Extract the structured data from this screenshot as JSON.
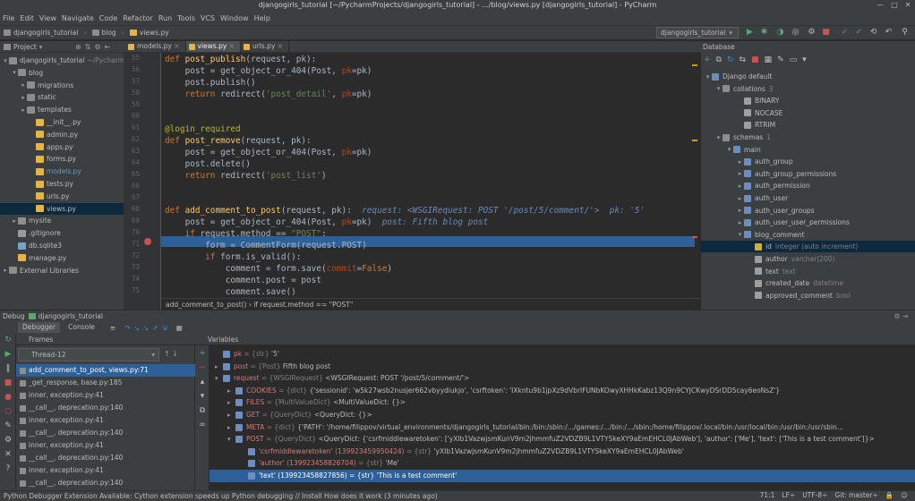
{
  "window": {
    "title": "djangogirls_tutorial [~/PycharmProjects/djangogirls_tutorial] - .../blog/views.py [djangogirls_tutorial] - PyCharm"
  },
  "menu": [
    "File",
    "Edit",
    "View",
    "Navigate",
    "Code",
    "Refactor",
    "Run",
    "Tools",
    "VCS",
    "Window",
    "Help"
  ],
  "breadcrumbs": [
    "djangogirls_tutorial",
    "blog",
    "views.py"
  ],
  "run_config": "djangogirls_tutorial",
  "project_panel": {
    "title": "Project"
  },
  "tabs": [
    "models.py",
    "views.py",
    "urls.py"
  ],
  "tree": [
    {
      "label": "djangogirls_tutorial",
      "suffix": "~/Pycharm",
      "arrow": "▾",
      "icon": "folder",
      "indent": 0
    },
    {
      "label": "blog",
      "arrow": "▾",
      "icon": "folder",
      "indent": 1
    },
    {
      "label": "migrations",
      "arrow": "▸",
      "icon": "folder",
      "indent": 2
    },
    {
      "label": "static",
      "arrow": "▸",
      "icon": "folder",
      "indent": 2
    },
    {
      "label": "templates",
      "arrow": "▸",
      "icon": "folder",
      "indent": 2
    },
    {
      "label": "__init__.py",
      "arrow": "",
      "icon": "py",
      "indent": 3
    },
    {
      "label": "admin.py",
      "arrow": "",
      "icon": "py",
      "indent": 3
    },
    {
      "label": "apps.py",
      "arrow": "",
      "icon": "py",
      "indent": 3
    },
    {
      "label": "forms.py",
      "arrow": "",
      "icon": "py",
      "indent": 3
    },
    {
      "label": "models.py",
      "arrow": "",
      "icon": "py",
      "indent": 3,
      "blue": true
    },
    {
      "label": "tests.py",
      "arrow": "",
      "icon": "py",
      "indent": 3
    },
    {
      "label": "urls.py",
      "arrow": "",
      "icon": "py",
      "indent": 3
    },
    {
      "label": "views.py",
      "arrow": "",
      "icon": "py",
      "indent": 3,
      "selected": true
    },
    {
      "label": "mysite",
      "arrow": "▸",
      "icon": "folder",
      "indent": 1
    },
    {
      "label": ".gitignore",
      "arrow": "",
      "icon": "misc",
      "indent": 1
    },
    {
      "label": "db.sqlite3",
      "arrow": "",
      "icon": "db",
      "indent": 1
    },
    {
      "label": "manage.py",
      "arrow": "",
      "icon": "py",
      "indent": 1
    },
    {
      "label": "External Libraries",
      "arrow": "▸",
      "icon": "folder",
      "indent": 0
    }
  ],
  "line_numbers": [
    "55",
    "56",
    "57",
    "58",
    "59",
    "60",
    "61",
    "62",
    "63",
    "64",
    "65",
    "66",
    "67",
    "68",
    "69",
    "70",
    "71",
    "72",
    "73",
    "74",
    "75"
  ],
  "code_lines": [
    [
      [
        "kw",
        "def "
      ],
      [
        "fn",
        "post_publish"
      ],
      [
        "",
        "(request, pk):"
      ]
    ],
    [
      [
        "",
        "    post = get_object_or_404(Post, "
      ],
      [
        "par",
        "pk"
      ],
      [
        "",
        "=pk)"
      ]
    ],
    [
      [
        "",
        "    post.publish()"
      ]
    ],
    [
      [
        "kw",
        "    return "
      ],
      [
        "",
        "redirect("
      ],
      [
        "st",
        "'post_detail'"
      ],
      [
        "",
        ", "
      ],
      [
        "par",
        "pk"
      ],
      [
        "",
        "=pk)"
      ]
    ],
    [
      [
        "",
        ""
      ]
    ],
    [
      [
        "",
        ""
      ]
    ],
    [
      [
        "dec",
        "@login_required"
      ]
    ],
    [
      [
        "kw",
        "def "
      ],
      [
        "fn",
        "post_remove"
      ],
      [
        "",
        "(request, pk):"
      ]
    ],
    [
      [
        "",
        "    post = get_object_or_404(Post, "
      ],
      [
        "par",
        "pk"
      ],
      [
        "",
        "=pk)"
      ]
    ],
    [
      [
        "",
        "    post.delete()"
      ]
    ],
    [
      [
        "kw",
        "    return "
      ],
      [
        "",
        "redirect("
      ],
      [
        "st",
        "'post_list'"
      ],
      [
        "",
        ")"
      ]
    ],
    [
      [
        "",
        ""
      ]
    ],
    [
      [
        "",
        ""
      ]
    ],
    [
      [
        "kw",
        "def "
      ],
      [
        "fn",
        "add_comment_to_post"
      ],
      [
        "",
        "(request, pk):  "
      ],
      [
        "hint",
        "request: <WSGIRequest: POST '/post/5/comment/'>  pk: '5'"
      ]
    ],
    [
      [
        "",
        "    post = get_object_or_404(Post, "
      ],
      [
        "par",
        "pk"
      ],
      [
        "",
        "=pk)  "
      ],
      [
        "hint",
        "post: Fifth blog post"
      ]
    ],
    [
      [
        "kw",
        "    if "
      ],
      [
        "",
        "request.method == "
      ],
      [
        "st",
        "\"POST\""
      ],
      [
        "",
        ":"
      ]
    ],
    [
      [
        "",
        "        form = CommentForm(request.POST)"
      ]
    ],
    [
      [
        "kw",
        "        if "
      ],
      [
        "",
        "form.is_valid():"
      ]
    ],
    [
      [
        "",
        "            comment = form.save("
      ],
      [
        "par",
        "commit"
      ],
      [
        "",
        "="
      ],
      [
        "kw",
        "False"
      ],
      [
        "",
        ")"
      ]
    ],
    [
      [
        "",
        "            comment.post = post"
      ]
    ],
    [
      [
        "",
        "            comment.save()"
      ]
    ]
  ],
  "editor_breadcrumb": "add_comment_to_post()  ›  if request.method == \"POST\"",
  "db": {
    "title": "Database",
    "rows": [
      {
        "label": "Django default",
        "arrow": "▾",
        "icon": "tbl",
        "indent": 0,
        "count": ""
      },
      {
        "label": "collations",
        "arrow": "▾",
        "icon": "folder",
        "indent": 1,
        "count": "3"
      },
      {
        "label": "BINARY",
        "arrow": "",
        "icon": "col",
        "indent": 3,
        "count": ""
      },
      {
        "label": "NOCASE",
        "arrow": "",
        "icon": "col",
        "indent": 3,
        "count": ""
      },
      {
        "label": "RTRIM",
        "arrow": "",
        "icon": "col",
        "indent": 3,
        "count": ""
      },
      {
        "label": "schemas",
        "arrow": "▾",
        "icon": "folder",
        "indent": 1,
        "count": "1"
      },
      {
        "label": "main",
        "arrow": "▾",
        "icon": "tbl",
        "indent": 2,
        "count": ""
      },
      {
        "label": "auth_group",
        "arrow": "▸",
        "icon": "tbl",
        "indent": 3,
        "count": ""
      },
      {
        "label": "auth_group_permissions",
        "arrow": "▸",
        "icon": "tbl",
        "indent": 3,
        "count": ""
      },
      {
        "label": "auth_permission",
        "arrow": "▸",
        "icon": "tbl",
        "indent": 3,
        "count": ""
      },
      {
        "label": "auth_user",
        "arrow": "▸",
        "icon": "tbl",
        "indent": 3,
        "count": ""
      },
      {
        "label": "auth_user_groups",
        "arrow": "▸",
        "icon": "tbl",
        "indent": 3,
        "count": ""
      },
      {
        "label": "auth_user_user_permissions",
        "arrow": "▸",
        "icon": "tbl",
        "indent": 3,
        "count": ""
      },
      {
        "label": "blog_comment",
        "arrow": "▾",
        "icon": "tbl",
        "indent": 3,
        "count": ""
      },
      {
        "label": "id",
        "type": "integer (auto increment)",
        "arrow": "",
        "icon": "key",
        "indent": 4,
        "selected": true
      },
      {
        "label": "author",
        "type": "varchar(200)",
        "arrow": "",
        "icon": "col",
        "indent": 4
      },
      {
        "label": "text",
        "type": "text",
        "arrow": "",
        "icon": "col",
        "indent": 4
      },
      {
        "label": "created_date",
        "type": "datetime",
        "arrow": "",
        "icon": "col",
        "indent": 4
      },
      {
        "label": "approved_comment",
        "type": "bool",
        "arrow": "",
        "icon": "col",
        "indent": 4
      }
    ]
  },
  "debug": {
    "title": "Debug",
    "config": "djangogirls_tutorial",
    "tabs": [
      "Debugger",
      "Console"
    ],
    "frames_title": "Frames",
    "variables_title": "Variables",
    "thread": "Thread-12",
    "frames": [
      {
        "label": "add_comment_to_post, views.py:71",
        "selected": true
      },
      {
        "label": "_get_response, base.py:185"
      },
      {
        "label": "inner, exception.py:41"
      },
      {
        "label": "__call__, deprecation.py:140"
      },
      {
        "label": "inner, exception.py:41"
      },
      {
        "label": "__call__, deprecation.py:140"
      },
      {
        "label": "inner, exception.py:41"
      },
      {
        "label": "__call__, deprecation.py:140"
      },
      {
        "label": "inner, exception.py:41"
      },
      {
        "label": "__call__, deprecation.py:140"
      }
    ],
    "variables": [
      {
        "arrow": "",
        "indent": 0,
        "name": "pk",
        "type": "= {str}",
        "value": "'5'"
      },
      {
        "arrow": "▸",
        "indent": 0,
        "name": "post",
        "type": "= {Post}",
        "value": "Fifth blog post"
      },
      {
        "arrow": "▾",
        "indent": 0,
        "name": "request",
        "type": "= {WSGIRequest}",
        "value": "<WSGIRequest: POST '/post/5/comment/'>"
      },
      {
        "arrow": "▸",
        "indent": 1,
        "name": "COOKIES",
        "type": "= {dict}",
        "value": "{'sessionid': 'w5k27wsb2nusjer662vbyydiukjo', 'csrftoken': 'IXkntu9b1jpXz9dVbrIFUNbKOwyXHHkKabz13Q9n9CYJCKwyDSrDD5cay6eoNsZ'}"
      },
      {
        "arrow": "▸",
        "indent": 1,
        "name": "FILES",
        "type": "= {MultiValueDict}",
        "value": "<MultiValueDict: {}>"
      },
      {
        "arrow": "▸",
        "indent": 1,
        "name": "GET",
        "type": "= {QueryDict}",
        "value": "<QueryDict: {}>"
      },
      {
        "arrow": "▸",
        "indent": 1,
        "name": "META",
        "type": "= {dict}",
        "value": "{'PATH': '/home/filippov/virtual_environments/djangogirls_tutorial/bin:/bin:/sbin:/.../games:/.../bin:/.../sbin:/home/filippov/.local/bin:/usr/local/bin:/usr/bin:/usr/sbin..."
      },
      {
        "arrow": "▾",
        "indent": 1,
        "name": "POST",
        "type": "= {QueryDict}",
        "value": "<QueryDict: {'csrfmiddlewaretoken': ['yXIb1VazwjsmKunV9m2jhmmfuZ2VDZB9L1VTYSkeXY9aEmEHCL0JAbWeb'], 'author': ['Me'], 'text': ['This is a test comment']}>"
      },
      {
        "arrow": "",
        "indent": 2,
        "name": "'csrfmiddlewaretoken' (139923459950424)",
        "type": "= {str}",
        "value": "'yXIb1VazwjsmKunV9m2jhmmfuZ2VDZB9L1VTYSkeXY9aEmEHCL0JAbWeb'"
      },
      {
        "arrow": "",
        "indent": 2,
        "name": "'author' (139923458826704)",
        "type": "= {str}",
        "value": "'Me'"
      },
      {
        "arrow": "",
        "indent": 2,
        "name": "'text' (139923458827856)",
        "type": "= {str}",
        "value": "'This is a test comment'",
        "selected": true
      }
    ]
  },
  "status": {
    "message": "Python Debugger Extension Available: Cython extension speeds up Python debugging // Install How does it work (3 minutes ago)",
    "position": "71:1",
    "line_sep": "LF÷",
    "encoding": "UTF-8÷",
    "git": "Git: master÷"
  },
  "colors": {
    "accent": "#2d6099",
    "breakpoint": "#c75450",
    "keyword": "#cc7832",
    "string": "#6a8759",
    "function": "#ffc66d"
  }
}
